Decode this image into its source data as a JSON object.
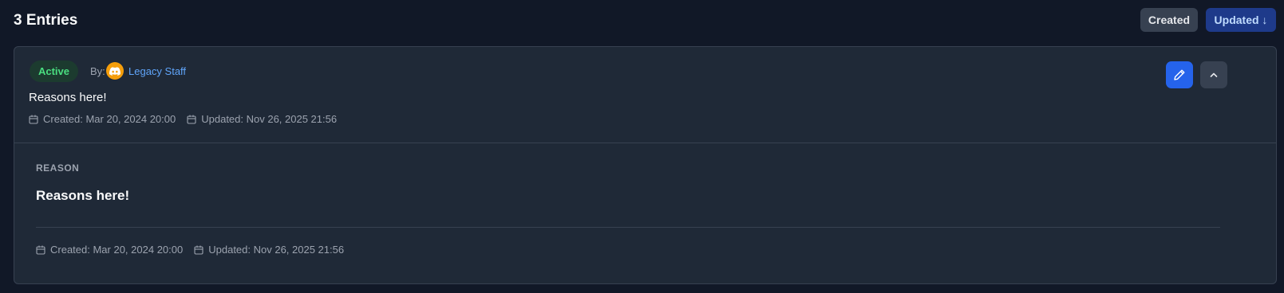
{
  "header": {
    "title": "3 Entries",
    "sort_created_label": "Created",
    "sort_updated_label": "Updated ↓"
  },
  "entry": {
    "status": "Active",
    "by_label": "By:",
    "author": "Legacy Staff",
    "author_icon": "discord-icon",
    "reason": "Reasons here!",
    "created": "Created: Mar 20, 2024 20:00",
    "updated": "Updated: Nov 26, 2025 21:56",
    "actions": {
      "edit_icon": "pencil-icon",
      "collapse_icon": "chevron-up-icon"
    },
    "detail": {
      "label": "REASON",
      "reason": "Reasons here!",
      "created": "Created: Mar 20, 2024 20:00",
      "updated": "Updated: Nov 26, 2025 21:56"
    }
  },
  "colors": {
    "background": "#111827",
    "card": "#1f2937",
    "accent": "#2563eb",
    "active_green": "#4ade80",
    "link": "#60a5fa"
  }
}
